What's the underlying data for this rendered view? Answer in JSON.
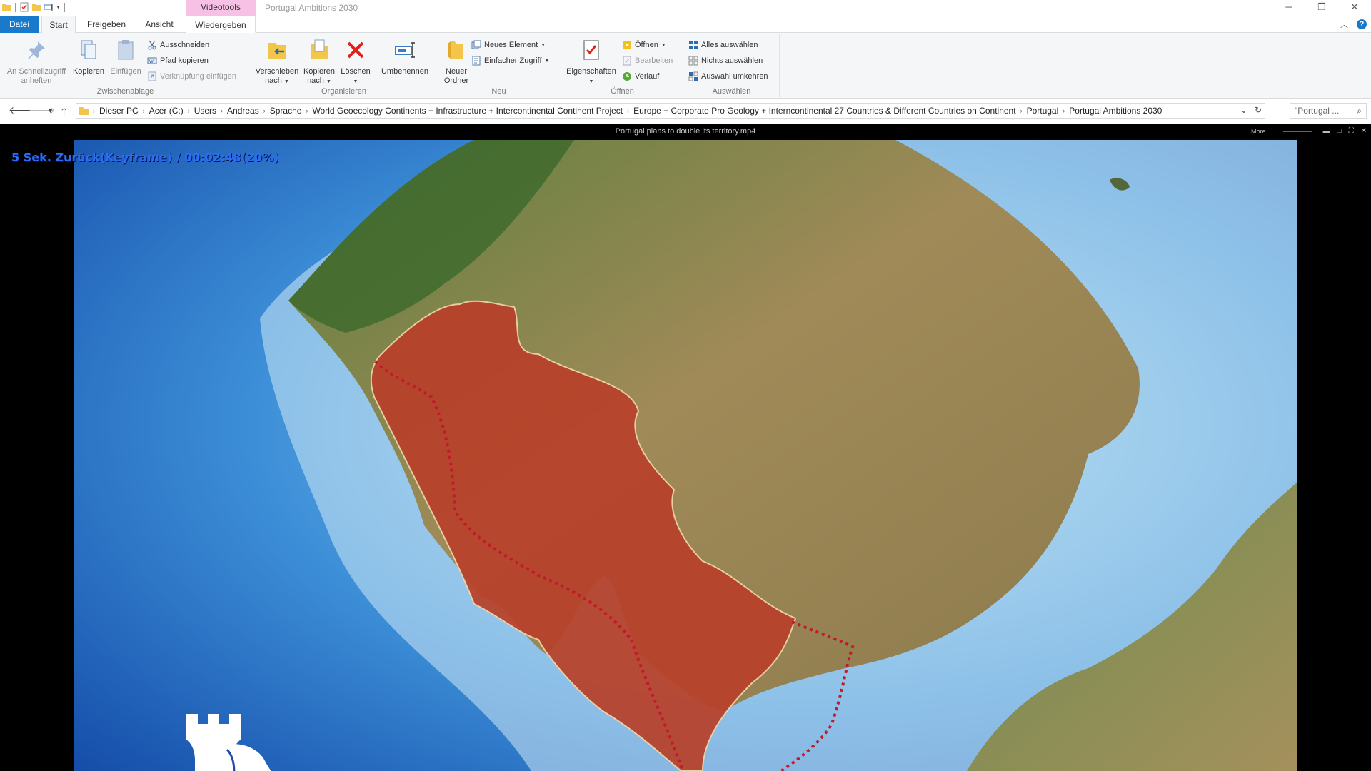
{
  "window": {
    "title": "Portugal Ambitions 2030",
    "context_tab_header": "Videotools"
  },
  "tabs": {
    "file": "Datei",
    "start": "Start",
    "share": "Freigeben",
    "view": "Ansicht",
    "play": "Wiedergeben"
  },
  "ribbon": {
    "clipboard": {
      "label": "Zwischenablage",
      "pin_line1": "An Schnellzugriff",
      "pin_line2": "anheften",
      "copy": "Kopieren",
      "paste": "Einfügen",
      "cut": "Ausschneiden",
      "copy_path": "Pfad kopieren",
      "paste_shortcut": "Verknüpfung einfügen"
    },
    "organize": {
      "label": "Organisieren",
      "move_line1": "Verschieben",
      "move_line2": "nach",
      "copyto_line1": "Kopieren",
      "copyto_line2": "nach",
      "delete": "Löschen",
      "rename": "Umbenennen"
    },
    "new": {
      "label": "Neu",
      "new_folder_line1": "Neuer",
      "new_folder_line2": "Ordner",
      "new_item": "Neues Element",
      "easy_access": "Einfacher Zugriff"
    },
    "open": {
      "label": "Öffnen",
      "properties": "Eigenschaften",
      "open": "Öffnen",
      "edit": "Bearbeiten",
      "history": "Verlauf"
    },
    "select": {
      "label": "Auswählen",
      "select_all": "Alles auswählen",
      "select_none": "Nichts auswählen",
      "invert": "Auswahl umkehren"
    }
  },
  "address": {
    "crumbs": [
      "Dieser PC",
      "Acer (C:)",
      "Users",
      "Andreas",
      "Sprache",
      "World Geoecology Continents + Infrastructure + Intercontinental Continent Project",
      "Europe + Corporate Pro Geology + Interncontinental 27 Countries & Different Countries on Continent",
      "Portugal",
      "Portugal Ambitions 2030"
    ],
    "search_placeholder": "\"Portugal ..."
  },
  "player": {
    "file_title": "Portugal plans to double its territory.mp4",
    "more_label": "More",
    "osd_text": "5  Sek. Zurück(Keyframe) / 00:02:48(20%)",
    "progress_percent": 20
  },
  "colors": {
    "accent": "#1979ca",
    "context_tab": "#f6c1e5",
    "osd_text": "#2d6cf5",
    "territory_fill": "#b8412a",
    "border_dotted": "#c11a2b"
  },
  "icons": {
    "pin": "pin-icon",
    "copy": "copy-icon",
    "paste": "paste-icon",
    "cut": "scissors-icon",
    "delete": "delete-x-icon",
    "rename": "rename-icon",
    "folder": "new-folder-icon",
    "properties": "properties-checklist-icon",
    "search": "search-icon",
    "refresh": "refresh-icon"
  }
}
